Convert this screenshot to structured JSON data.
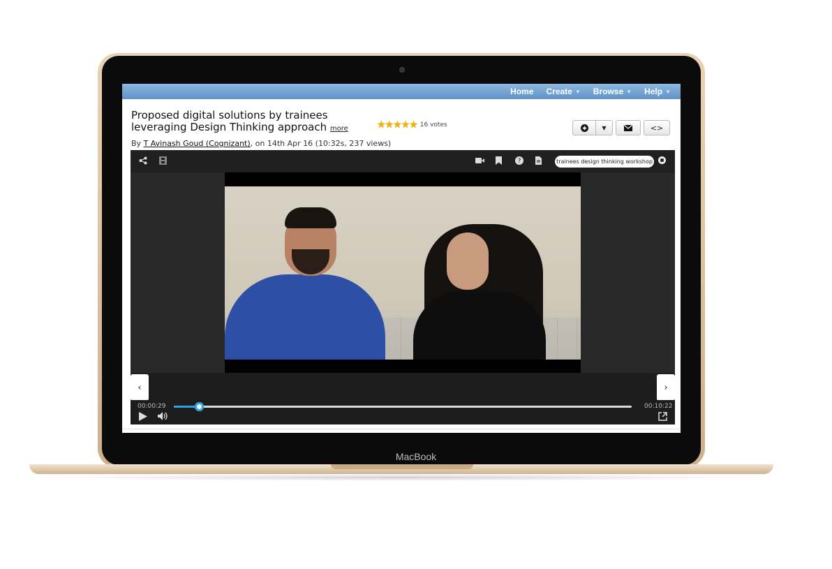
{
  "device": {
    "brand_label": "MacBook"
  },
  "nav": {
    "items": [
      {
        "label": "Home",
        "has_caret": false
      },
      {
        "label": "Create",
        "has_caret": true
      },
      {
        "label": "Browse",
        "has_caret": true
      },
      {
        "label": "Help",
        "has_caret": true
      }
    ]
  },
  "video": {
    "title": "Proposed digital solutions by trainees leveraging Design Thinking approach",
    "more_label": "more",
    "by_prefix": "By",
    "author": "T Avinash Goud (Cognizant)",
    "meta": ", on 14th Apr 16 (10:32s, 237 views)",
    "rating": {
      "stars": 5,
      "stars_glyph": "★★★★★",
      "votes": "16 votes"
    }
  },
  "actions": {
    "add_icon": "add-circle-icon",
    "dropdown_icon": "caret-down-icon",
    "email_icon": "envelope-icon",
    "embed_label": "<>"
  },
  "player": {
    "toolbar_icons": [
      "share-icon",
      "film-icon",
      "camera-icon",
      "bookmark-icon",
      "help-icon",
      "document-icon"
    ],
    "tag": "trainees design thinking workshop",
    "current_time": "00:00:29",
    "duration": "00:10:22",
    "progress": 0.055,
    "prev_label": "‹",
    "next_label": "›"
  },
  "colors": {
    "nav_bg": "#6b9dd0",
    "accent": "#2ca0e8",
    "star": "#f4b400"
  }
}
